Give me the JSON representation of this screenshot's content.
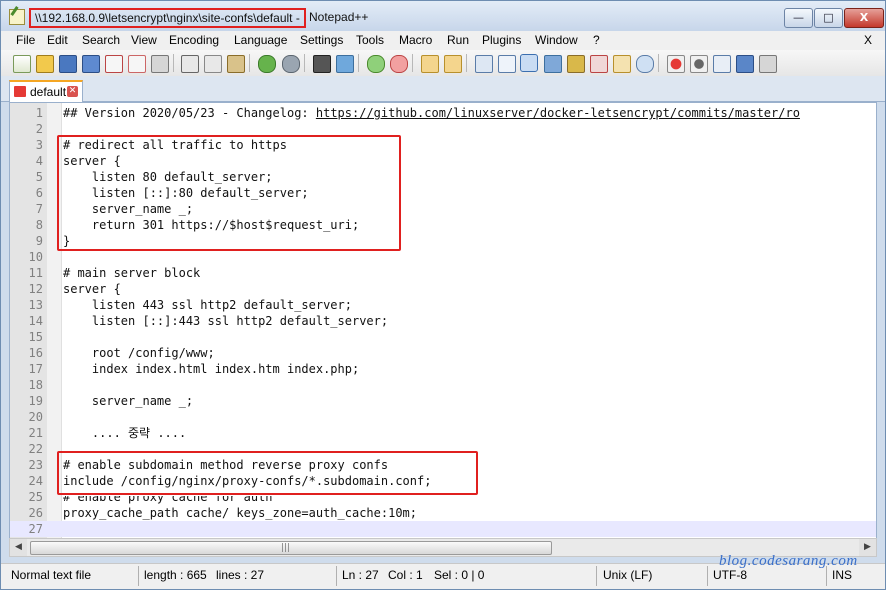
{
  "window": {
    "title_path": "\\\\192.168.0.9\\letsencrypt\\nginx\\site-confs\\default -",
    "title_app": "Notepad++",
    "minimize_glyph": "—",
    "maximize_glyph": "□",
    "close_glyph": "X"
  },
  "menu": {
    "items": [
      "File",
      "Edit",
      "Search",
      "View",
      "Encoding",
      "Language",
      "Settings",
      "Tools",
      "Macro",
      "Run",
      "Plugins",
      "Window",
      "?"
    ],
    "close_glyph": "X"
  },
  "toolbar": {
    "icons": [
      "new-file-icon",
      "open-file-icon",
      "save-icon",
      "save-all-icon",
      "close-file-icon",
      "close-all-icon",
      "print-icon",
      "cut-icon",
      "copy-icon",
      "paste-icon",
      "undo-icon",
      "redo-icon",
      "find-icon",
      "replace-icon",
      "zoom-in-icon",
      "zoom-out-icon",
      "sync-vertical-icon",
      "sync-horizontal-icon",
      "word-wrap-icon",
      "show-all-chars-icon",
      "indent-guide-icon",
      "doc-map-icon",
      "function-list-icon",
      "folder-workspace-icon",
      "monitoring-icon",
      "record-macro-icon",
      "stop-macro-icon",
      "play-macro-icon",
      "run-macro-multiple-icon",
      "save-macro-icon"
    ]
  },
  "tab": {
    "label": "default",
    "close_glyph": "✕"
  },
  "editor": {
    "lines": [
      {
        "n": "1",
        "pre": "## Version 2020/05/23 - Changelog: ",
        "link": "https://github.com/linuxserver/docker-letsencrypt/commits/master/ro"
      },
      {
        "n": "2",
        "text": ""
      },
      {
        "n": "3",
        "text": "# redirect all traffic to https"
      },
      {
        "n": "4",
        "text": "server {"
      },
      {
        "n": "5",
        "text": "    listen 80 default_server;"
      },
      {
        "n": "6",
        "text": "    listen [::]:80 default_server;"
      },
      {
        "n": "7",
        "text": "    server_name _;"
      },
      {
        "n": "8",
        "text": "    return 301 https://$host$request_uri;"
      },
      {
        "n": "9",
        "text": "}"
      },
      {
        "n": "10",
        "text": ""
      },
      {
        "n": "11",
        "text": "# main server block"
      },
      {
        "n": "12",
        "text": "server {"
      },
      {
        "n": "13",
        "text": "    listen 443 ssl http2 default_server;"
      },
      {
        "n": "14",
        "text": "    listen [::]:443 ssl http2 default_server;"
      },
      {
        "n": "15",
        "text": ""
      },
      {
        "n": "16",
        "text": "    root /config/www;"
      },
      {
        "n": "17",
        "text": "    index index.html index.htm index.php;"
      },
      {
        "n": "18",
        "text": ""
      },
      {
        "n": "19",
        "text": "    server_name _;"
      },
      {
        "n": "20",
        "text": ""
      },
      {
        "n": "21",
        "text": "    .... 중략 ...."
      },
      {
        "n": "22",
        "text": ""
      },
      {
        "n": "23",
        "text": "# enable subdomain method reverse proxy confs"
      },
      {
        "n": "24",
        "text": "include /config/nginx/proxy-confs/*.subdomain.conf;"
      },
      {
        "n": "25",
        "text": "# enable proxy cache for auth"
      },
      {
        "n": "26",
        "text": "proxy_cache_path cache/ keys_zone=auth_cache:10m;"
      },
      {
        "n": "27",
        "text": ""
      }
    ]
  },
  "scrollbar": {
    "left_glyph": "◀",
    "right_glyph": "▶",
    "grip_glyph": "|||"
  },
  "status": {
    "file_type": "Normal text file",
    "length": "length : 665",
    "lines": "lines : 27",
    "ln": "Ln : 27",
    "col": "Col : 1",
    "sel": "Sel : 0 | 0",
    "eol": "Unix (LF)",
    "encoding": "UTF-8",
    "mode": "INS"
  },
  "watermark": "blog.codesarang.com",
  "colors": {
    "highlight_box": "#e0201f",
    "link_text": "#111111",
    "watermark": "#3a6fc9"
  }
}
